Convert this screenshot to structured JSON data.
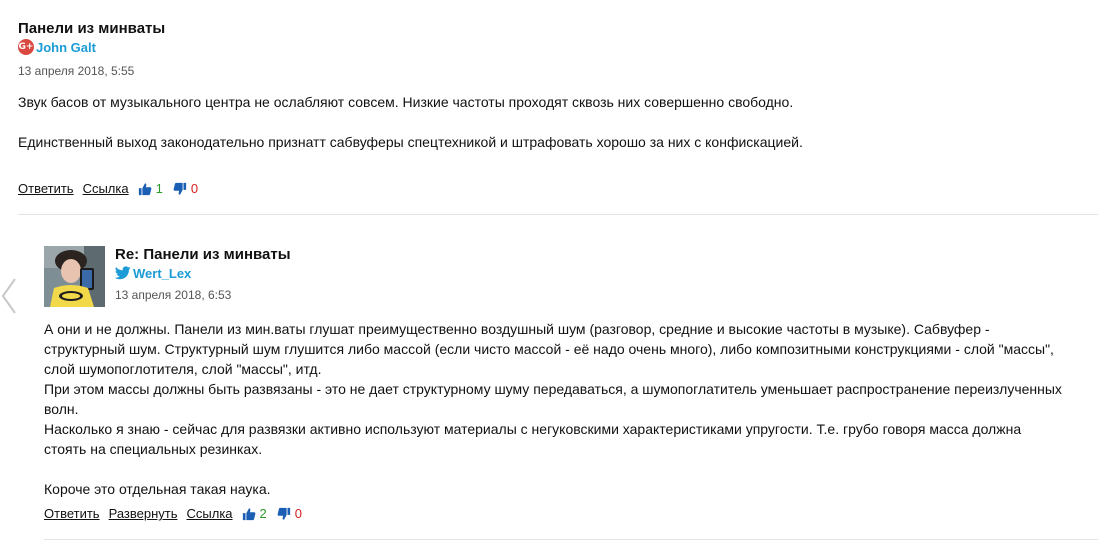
{
  "comment1": {
    "title": "Панели из минваты",
    "author": "John Galt",
    "author_network": "google-plus-icon",
    "date": "13 апреля 2018, 5:55",
    "paragraphs": [
      "Звук басов от музыкального центра не ослабляют совсем. Низкие частоты проходят сквозь них совершенно свободно.",
      "Единственный выход законодательно признатт сабвуферы спецтехникой и штрафовать хорошо за них с конфискацией."
    ],
    "actions": {
      "reply": "Ответить",
      "link": "Ссылка",
      "upvotes": "1",
      "downvotes": "0"
    }
  },
  "comment2": {
    "title": "Re: Панели из минваты",
    "author": "Wert_Lex",
    "author_network": "twitter-icon",
    "date": "13 апреля 2018, 6:53",
    "lines": [
      "А они и не должны. Панели из мин.ваты глушат преимущественно воздушный шум (разговор, средние и высокие частоты в музыке). Сабвуфер -",
      "структурный шум. Структурный шум глушится либо массой (если чисто массой - её надо очень много), либо композитными конструкциями - слой \"массы\",",
      "слой шумопоглотителя, слой \"массы\", итд.",
      "При этом массы должны быть развязаны - это не дает структурному шуму передаваться, а шумопоглатитель уменьшает распространение переизлученных",
      "волн.",
      "Насколько я знаю - сейчас для развязки активно используют материалы с негуковскими характеристиками упругости. Т.е. грубо говоря масса должна",
      "стоять на специальных резинках."
    ],
    "closing": "Короче это отдельная такая наука.",
    "actions": {
      "reply": "Ответить",
      "expand": "Развернуть",
      "link": "Ссылка",
      "upvotes": "2",
      "downvotes": "0"
    }
  },
  "colors": {
    "author_link": "#1c9bd6",
    "upvote": "#2a9a2a",
    "downvote": "#d21f1f",
    "thumb_icon": "#1a5fb4"
  }
}
